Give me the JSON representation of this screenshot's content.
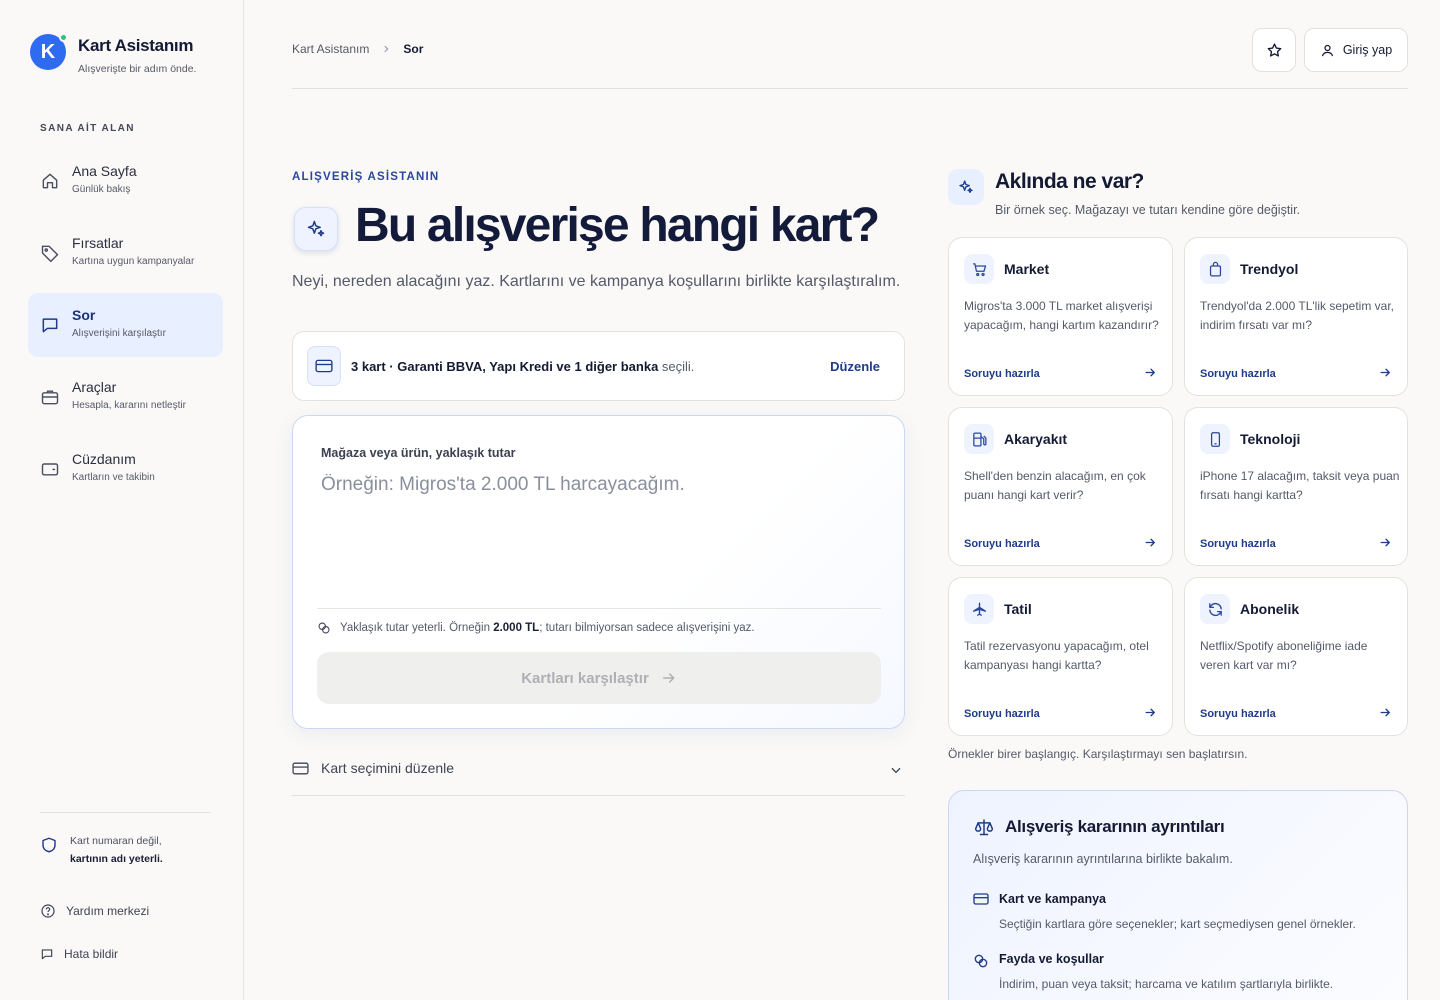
{
  "brand": {
    "title": "Kart Asistanım",
    "subtitle": "Alışverişte bir adım önde.",
    "logo_letter": "K"
  },
  "sidebar": {
    "section_label": "SANA AİT ALAN",
    "items": [
      {
        "title": "Ana Sayfa",
        "sub": "Günlük bakış",
        "icon": "home-icon",
        "active": false
      },
      {
        "title": "Fırsatlar",
        "sub": "Kartına uygun kampanyalar",
        "icon": "tag-icon",
        "active": false
      },
      {
        "title": "Sor",
        "sub": "Alışverişini karşılaştır",
        "icon": "chat-icon",
        "active": true
      },
      {
        "title": "Araçlar",
        "sub": "Hesapla, kararını netleştir",
        "icon": "briefcase-icon",
        "active": false
      },
      {
        "title": "Cüzdanım",
        "sub": "Kartların ve takibin",
        "icon": "wallet-icon",
        "active": false
      }
    ],
    "privacy_line1": "Kart numaran değil,",
    "privacy_line2": "kartının adı yeterli.",
    "help": "Yardım merkezi",
    "report": "Hata bildir"
  },
  "header": {
    "breadcrumb_root": "Kart Asistanım",
    "breadcrumb_current": "Sor",
    "login_label": "Giriş yap"
  },
  "main": {
    "eyebrow": "ALIŞVERİŞ ASİSTANIN",
    "title": "Bu alışverişe hangi kart?",
    "subtitle": "Neyi, nereden alacağını yaz. Kartlarını ve kampanya koşullarını birlikte karşılaştıralım.",
    "card_strip": {
      "bold": "3 kart · Garanti BBVA, Yapı Kredi ve 1 diğer banka",
      "rest": " seçili.",
      "edit": "Düzenle"
    },
    "composer": {
      "label": "Mağaza veya ürün, yaklaşık tutar",
      "placeholder": "Örneğin: Migros'ta 2.000 TL harcayacağım.",
      "value": "",
      "hint_pre": "Yaklaşık tutar yeterli. Örneğin ",
      "hint_bold": "2.000 TL",
      "hint_post": "; tutarı bilmiyorsan sadece alışverişini yaz.",
      "button": "Kartları karşılaştır"
    },
    "edit_cards": "Kart seçimini düzenle"
  },
  "examples": {
    "title": "Aklında ne var?",
    "subtitle": "Bir örnek seç. Mağazayı ve tutarı kendine göre değiştir.",
    "cta": "Soruyu hazırla",
    "items": [
      {
        "title": "Market",
        "body": "Migros'ta 3.000 TL market alışverişi yapacağım, hangi kartım kazandırır?",
        "icon": "cart-icon"
      },
      {
        "title": "Trendyol",
        "body": "Trendyol'da 2.000 TL'lik sepetim var, indirim fırsatı var mı?",
        "icon": "shopping-bag-icon"
      },
      {
        "title": "Akaryakıt",
        "body": "Shell'den benzin alacağım, en çok puanı hangi kart verir?",
        "icon": "fuel-icon"
      },
      {
        "title": "Teknoloji",
        "body": "iPhone 17 alacağım, taksit veya puan fırsatı hangi kartta?",
        "icon": "phone-icon"
      },
      {
        "title": "Tatil",
        "body": "Tatil rezervasyonu yapacağım, otel kampanyası hangi kartta?",
        "icon": "plane-icon"
      },
      {
        "title": "Abonelik",
        "body": "Netflix/Spotify aboneliğime iade veren kart var mı?",
        "icon": "refresh-icon"
      }
    ],
    "note": "Örnekler birer başlangıç. Karşılaştırmayı sen başlatırsın."
  },
  "details": {
    "title": "Alışveriş kararının ayrıntıları",
    "subtitle": "Alışveriş kararının ayrıntılarına birlikte bakalım.",
    "items": [
      {
        "title": "Kart ve kampanya",
        "body": "Seçtiğin kartlara göre seçenekler; kart seçmediysen genel örnekler."
      },
      {
        "title": "Fayda ve koşullar",
        "body": "İndirim, puan veya taksit; harcama ve katılım şartlarıyla birlikte."
      }
    ]
  },
  "colors": {
    "accent": "#1f3c8a",
    "active_bg": "#e8efff",
    "brand": "#2f6bf0",
    "online_dot": "#2ec27e"
  }
}
